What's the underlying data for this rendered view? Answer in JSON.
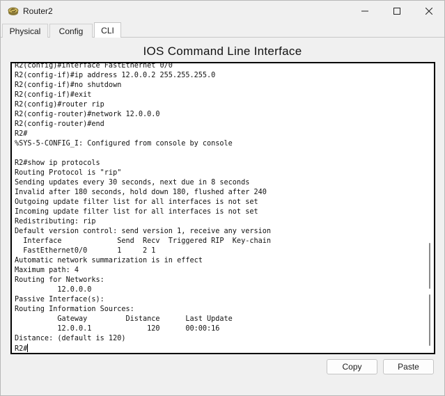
{
  "window": {
    "title": "Router2",
    "icons": {
      "app": "router-icon",
      "minimize": "minimize-icon",
      "maximize": "maximize-icon",
      "close": "close-icon"
    }
  },
  "tabs": [
    {
      "label": "Physical",
      "active": false
    },
    {
      "label": "Config",
      "active": false
    },
    {
      "label": "CLI",
      "active": true
    }
  ],
  "cli": {
    "heading": "IOS Command Line Interface",
    "lines": [
      "R2(config)#interface FastEthernet 0/0",
      "R2(config-if)#ip address 12.0.0.2 255.255.255.0",
      "R2(config-if)#no shutdown",
      "R2(config-if)#exit",
      "R2(config)#router rip",
      "R2(config-router)#network 12.0.0.0",
      "R2(config-router)#end",
      "R2#",
      "%SYS-5-CONFIG_I: Configured from console by console",
      "",
      "R2#show ip protocols",
      "Routing Protocol is \"rip\"",
      "Sending updates every 30 seconds, next due in 8 seconds",
      "Invalid after 180 seconds, hold down 180, flushed after 240",
      "Outgoing update filter list for all interfaces is not set",
      "Incoming update filter list for all interfaces is not set",
      "Redistributing: rip",
      "Default version control: send version 1, receive any version",
      "  Interface             Send  Recv  Triggered RIP  Key-chain",
      "  FastEthernet0/0       1     2 1",
      "Automatic network summarization is in effect",
      "Maximum path: 4",
      "Routing for Networks:",
      "          12.0.0.0",
      "Passive Interface(s):",
      "Routing Information Sources:",
      "          Gateway         Distance      Last Update",
      "          12.0.0.1             120      00:00:16",
      "Distance: (default is 120)",
      "R2#"
    ]
  },
  "buttons": {
    "copy": "Copy",
    "paste": "Paste"
  },
  "colors": {
    "window_bg": "#f0f0f0",
    "console_bg": "#ffffff",
    "console_border": "#000000",
    "text": "#111111"
  }
}
